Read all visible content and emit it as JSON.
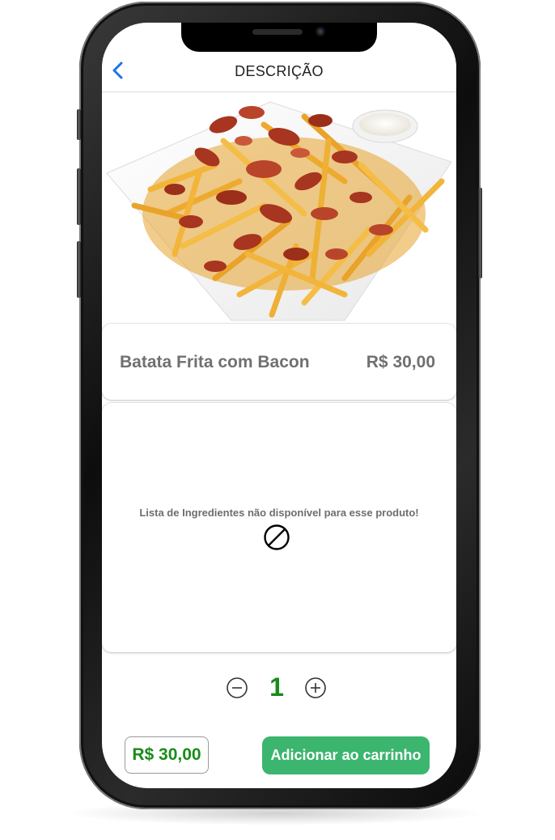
{
  "header": {
    "title": "DESCRIÇÃO",
    "back_icon": "chevron-left-icon",
    "accent_color": "#1a73e8"
  },
  "product": {
    "image_alt": "Batata Frita com Bacon",
    "name": "Batata Frita com Bacon",
    "price": "R$ 30,00"
  },
  "ingredients": {
    "message": "Lista de Ingredientes não disponível para esse produto!",
    "icon": "no-entry-icon"
  },
  "quantity": {
    "value": "1",
    "decrement_icon": "minus-circle-icon",
    "increment_icon": "plus-circle-icon"
  },
  "footer": {
    "total": "R$ 30,00",
    "add_button_label": "Adicionar ao carrinho",
    "total_color": "#198c19",
    "button_color": "#3cb56e"
  }
}
